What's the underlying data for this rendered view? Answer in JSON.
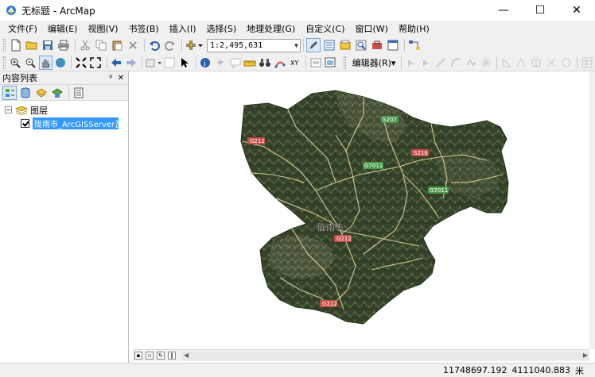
{
  "window": {
    "title": "无标题 - ArcMap",
    "minimize_glyph": "—",
    "maximize_glyph": "☐",
    "close_glyph": "✕"
  },
  "menu": [
    {
      "label": "文件(F)"
    },
    {
      "label": "编辑(E)"
    },
    {
      "label": "视图(V)"
    },
    {
      "label": "书签(B)"
    },
    {
      "label": "插入(I)"
    },
    {
      "label": "选择(S)"
    },
    {
      "label": "地理处理(G)"
    },
    {
      "label": "自定义(C)"
    },
    {
      "label": "窗口(W)"
    },
    {
      "label": "帮助(H)"
    }
  ],
  "toolbar": {
    "scale_value": "1:2,495,631",
    "editor_label": "编辑器(R)▾"
  },
  "toc": {
    "title": "内容列表",
    "pin_glyph": "ᵖ",
    "close_glyph": "✕",
    "root_label": "图层",
    "layer_label": "陇南市_ArcGISServer瓦片"
  },
  "map": {
    "city_label": "陇南市",
    "road_labels": [
      "G212",
      "G212",
      "G212",
      "S216",
      "G7011",
      "G7011",
      "S207"
    ]
  },
  "status": {
    "x": "11748697.192",
    "y": "4111040.883",
    "unit": "米"
  },
  "colors": {
    "terrain_dark": "#2f3b24",
    "terrain_mid": "#4a5a35",
    "road": "#e8d7a0",
    "road_shield": "#c9504a",
    "highlight": "#3399ff"
  }
}
